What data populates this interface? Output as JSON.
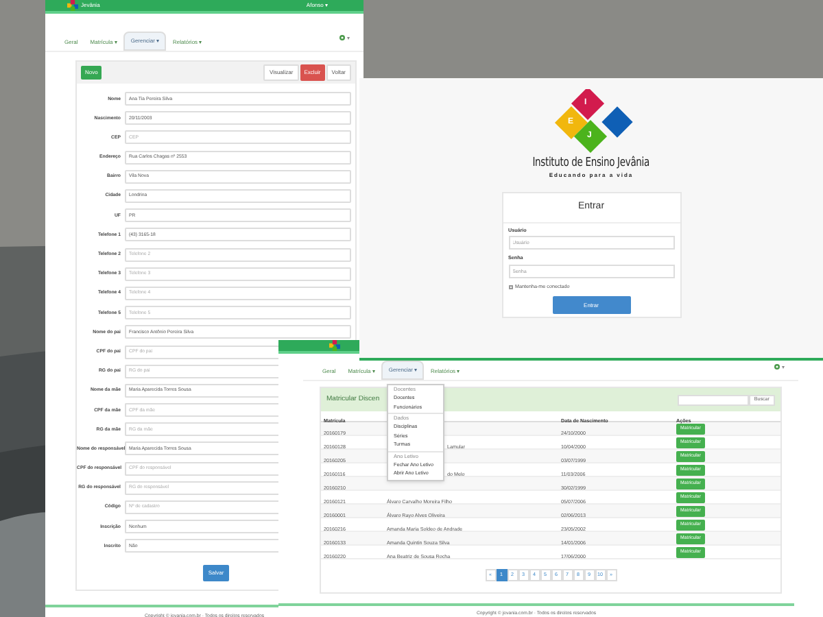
{
  "form_window": {
    "brand": "Jevânia",
    "user_menu": "Afonso ▾",
    "nav": [
      {
        "label": "Geral",
        "selected": false
      },
      {
        "label": "Matrícula ▾",
        "selected": false
      },
      {
        "label": "Gerenciar ▾",
        "selected": true
      },
      {
        "label": "Relatórios ▾",
        "selected": false
      }
    ],
    "settings_caret": "▾",
    "new_button": "Novo",
    "toolbar_buttons": [
      {
        "label": "Visualizar",
        "kind": "plain"
      },
      {
        "label": "Excluir",
        "kind": "danger"
      },
      {
        "label": "Voltar",
        "kind": "plain"
      }
    ],
    "fields": [
      {
        "label": "Nome",
        "value": "Ana Tia Pereira Silva"
      },
      {
        "label": "Nascimento",
        "value": "20/11/2003"
      },
      {
        "label": "CEP",
        "placeholder": "CEP"
      },
      {
        "label": "Endereço",
        "value": "Rua Carlos Chagas nº 2553"
      },
      {
        "label": "Bairro",
        "value": "Vila Nova"
      },
      {
        "label": "Cidade",
        "value": "Londrina"
      },
      {
        "label": "UF",
        "value": "PR"
      },
      {
        "label": "Telefone 1",
        "value": "(43) 3165-18"
      },
      {
        "label": "Telefone 2",
        "placeholder": "Telefone 2"
      },
      {
        "label": "Telefone 3",
        "placeholder": "Telefone 3"
      },
      {
        "label": "Telefone 4",
        "placeholder": "Telefone 4"
      },
      {
        "label": "Telefone 5",
        "placeholder": "Telefone 5"
      },
      {
        "label": "Nome do pai",
        "value": "Francisco Antônio Pereira Silva"
      },
      {
        "label": "CPF do pai",
        "placeholder": "CPF do pai"
      },
      {
        "label": "RG do pai",
        "placeholder": "RG do pai"
      },
      {
        "label": "Nome da mãe",
        "value": "Maria Aparecida Torres Sousa"
      },
      {
        "label": "CPF da mãe",
        "placeholder": "CPF da mãe"
      },
      {
        "label": "RG da mãe",
        "placeholder": "RG da mãe"
      },
      {
        "label": "Nome do responsável",
        "value": "Maria Aparecida Torres Sousa"
      },
      {
        "label": "CPF do responsável",
        "placeholder": "CPF do responsável"
      },
      {
        "label": "RG do responsável",
        "placeholder": "RG do responsável"
      },
      {
        "label": "Código",
        "placeholder": "Nº de cadastro"
      },
      {
        "label": "Inscrição",
        "value": "Nenhum"
      },
      {
        "label": "Inscrito",
        "value": "Não"
      }
    ],
    "submit": "Salvar",
    "footer": "Copyright © jevania.com.br · Todos os direitos reservados"
  },
  "login_window": {
    "institute": "Instituto de Ensino Jevânia",
    "tagline": "Educando para a vida",
    "logo_letters": [
      "I",
      "E",
      "J"
    ],
    "title": "Entrar",
    "user_label": "Usuário",
    "user_placeholder": "Usuário",
    "password_label": "Senha",
    "password_placeholder": "Senha",
    "remember": {
      "label": "Mantenha-me conectado",
      "checked": false
    },
    "submit": "Entrar"
  },
  "table_window": {
    "nav": [
      {
        "label": "Geral",
        "selected": false
      },
      {
        "label": "Matrícula ▾",
        "selected": false
      },
      {
        "label": "Gerenciar ▾",
        "selected": true
      },
      {
        "label": "Relatórios ▾",
        "selected": false
      }
    ],
    "settings_caret": "▾",
    "panel_title": "Matricular Discen",
    "search_button": "Buscar",
    "columns": [
      "Matrícula",
      "Data de Nascimento",
      "Ações"
    ],
    "rows": [
      {
        "id": "20160179",
        "date": "24/10/2000",
        "action": "Matricular"
      },
      {
        "id": "20160128",
        "name": "Lamular",
        "kind": "partial",
        "date": "10/04/2000",
        "action": "Matricular"
      },
      {
        "id": "20160205",
        "date": "03/07/1999",
        "action": "Matricular"
      },
      {
        "id": "20160116",
        "name": "do Melo",
        "kind": "partial",
        "date": "11/03/2006",
        "action": "Matricular"
      },
      {
        "id": "20160210",
        "date": "30/02/1999",
        "action": "Matricular"
      },
      {
        "id": "20160121",
        "name": "Álvaro Carvalho Moreira Filho",
        "kind": "full",
        "date": "05/07/2006",
        "action": "Matricular"
      },
      {
        "id": "20160001",
        "name": "Álvaro Rayo Alves Oliveira",
        "kind": "full",
        "date": "02/06/2013",
        "action": "Matricular"
      },
      {
        "id": "20160216",
        "name": "Amanda Maria Soldeo de Andrade",
        "kind": "full",
        "date": "23/05/2002",
        "action": "Matricular"
      },
      {
        "id": "20160133",
        "name": "Amanda Quintin Souza Silva",
        "kind": "full",
        "date": "14/01/2006",
        "action": "Matricular"
      },
      {
        "id": "20160220",
        "name": "Ana Beatriz de Sousa Rocha",
        "kind": "full",
        "date": "17/06/2000",
        "action": "Matricular"
      }
    ],
    "pages": [
      {
        "label": "«",
        "selected": false
      },
      {
        "label": "1",
        "selected": true
      },
      {
        "label": "2",
        "selected": false
      },
      {
        "label": "3",
        "selected": false
      },
      {
        "label": "4",
        "selected": false
      },
      {
        "label": "5",
        "selected": false
      },
      {
        "label": "6",
        "selected": false
      },
      {
        "label": "7",
        "selected": false
      },
      {
        "label": "8",
        "selected": false
      },
      {
        "label": "9",
        "selected": false
      },
      {
        "label": "10",
        "selected": false
      },
      {
        "label": "»",
        "selected": false
      }
    ],
    "menu": [
      {
        "kind": "header",
        "label": "Docentes"
      },
      {
        "kind": "item",
        "label": "Docentes"
      },
      {
        "kind": "item",
        "label": "Funcionários"
      },
      {
        "kind": "divider"
      },
      {
        "kind": "header",
        "label": "Dados"
      },
      {
        "kind": "item",
        "label": "Disciplinas"
      },
      {
        "kind": "item",
        "label": "Séries"
      },
      {
        "kind": "item",
        "label": "Turmas"
      },
      {
        "kind": "divider"
      },
      {
        "kind": "header",
        "label": "Ano Letivo"
      },
      {
        "kind": "item",
        "label": "Fechar Ano Letivo"
      },
      {
        "kind": "item",
        "label": "Abrir Ano Letivo"
      }
    ],
    "footer": "Copyright © jevania.com.br · Todos os direitos reservados"
  }
}
